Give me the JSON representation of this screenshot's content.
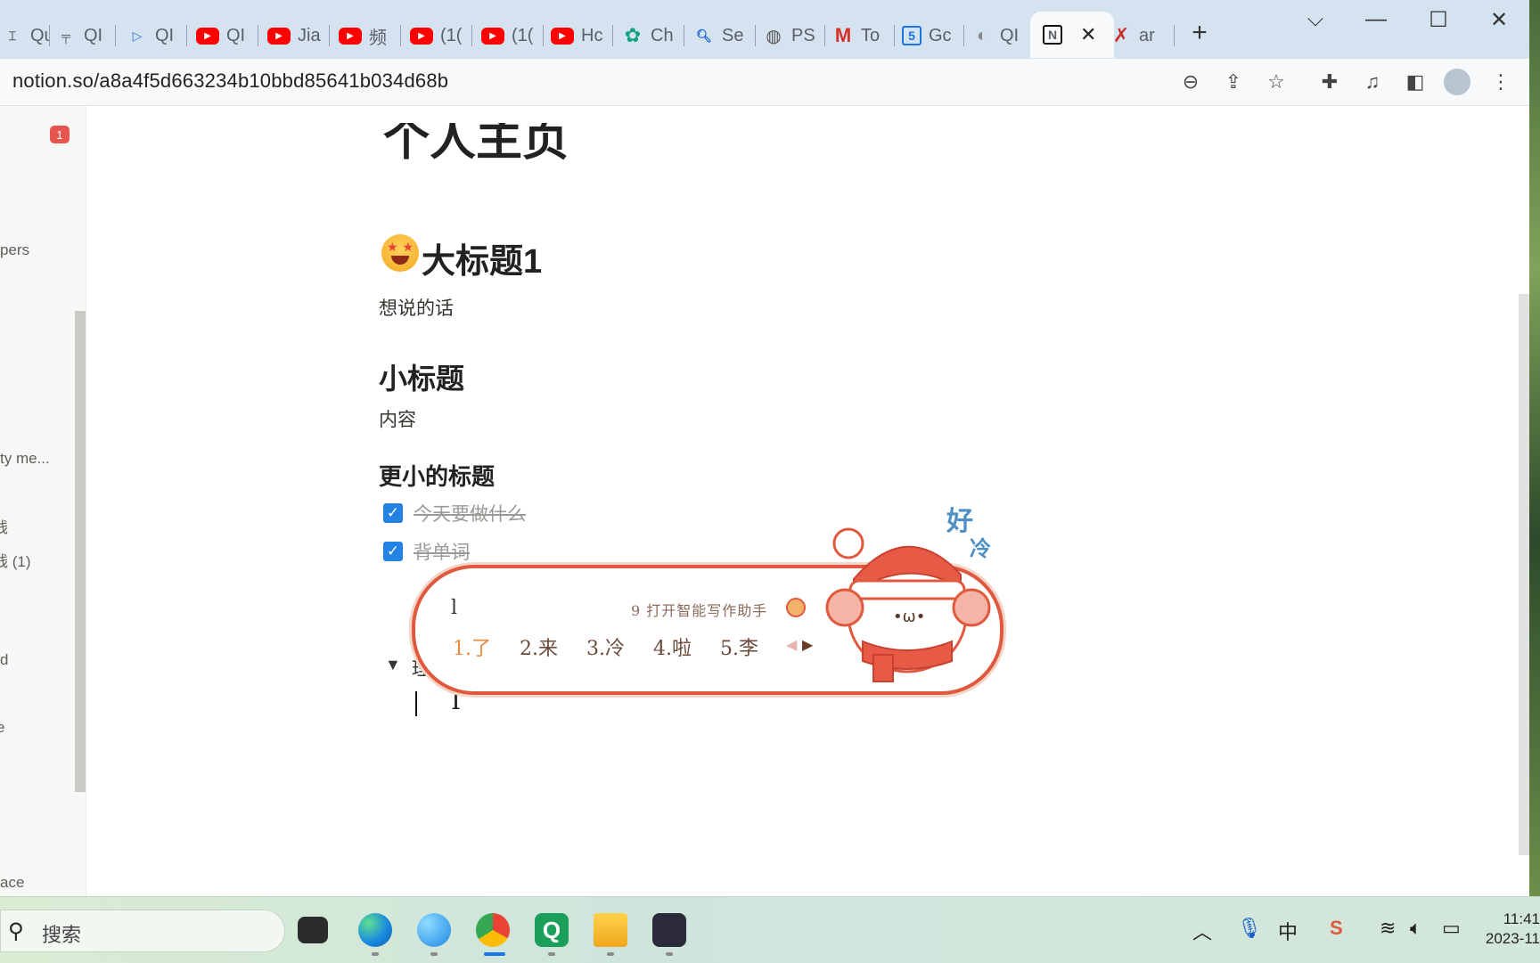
{
  "browser": {
    "tabs": [
      {
        "label": "Qu",
        "icon": "bracket-icon"
      },
      {
        "label": "QI",
        "icon": "dash-icon"
      },
      {
        "label": "QI",
        "icon": "play-outline-icon"
      },
      {
        "label": "QI",
        "icon": "youtube-icon"
      },
      {
        "label": "Jia",
        "icon": "youtube-icon"
      },
      {
        "label": "频",
        "icon": "youtube-icon"
      },
      {
        "label": "(1(",
        "icon": "youtube-icon"
      },
      {
        "label": "(1(",
        "icon": "youtube-icon"
      },
      {
        "label": "Hc",
        "icon": "youtube-icon"
      },
      {
        "label": "Ch",
        "icon": "chatgpt-icon"
      },
      {
        "label": "Se",
        "icon": "search-icon"
      },
      {
        "label": "PS",
        "icon": "globe-icon"
      },
      {
        "label": "To",
        "icon": "gmail-icon"
      },
      {
        "label": "Gc",
        "icon": "calendar-icon"
      },
      {
        "label": "QI",
        "icon": "compass-icon"
      },
      {
        "label": "",
        "icon": "notion-icon",
        "active": true
      },
      {
        "label": "ar",
        "icon": "x-logo-icon"
      }
    ],
    "url": "notion.so/a8a4f5d663234b10bbd85641b034d68b"
  },
  "sidebar": {
    "badge": "1",
    "items": [
      "pers",
      "ty me...",
      "钱",
      "钱 (1)",
      "d",
      "e",
      "ace"
    ]
  },
  "page": {
    "partial_title": "个人主页",
    "heading1": "大标题1",
    "para1": "想说的话",
    "heading2": "小标题",
    "para2": "内容",
    "heading3": "更小的标题",
    "todos": [
      {
        "text": "今天要做什么",
        "checked": true
      },
      {
        "text": "背单词",
        "checked": true
      }
    ],
    "toggle_text": "理"
  },
  "ime": {
    "input": "l",
    "hint_number": "9",
    "hint": "打开智能写作助手",
    "candidates": [
      "1.了",
      "2.来",
      "3.冷",
      "4.啦",
      "5.李"
    ],
    "mascot_text": [
      "好",
      "冷"
    ]
  },
  "taskbar": {
    "search_placeholder": "搜索",
    "ime_mode": "中",
    "time": "11:41",
    "date": "2023-11"
  }
}
